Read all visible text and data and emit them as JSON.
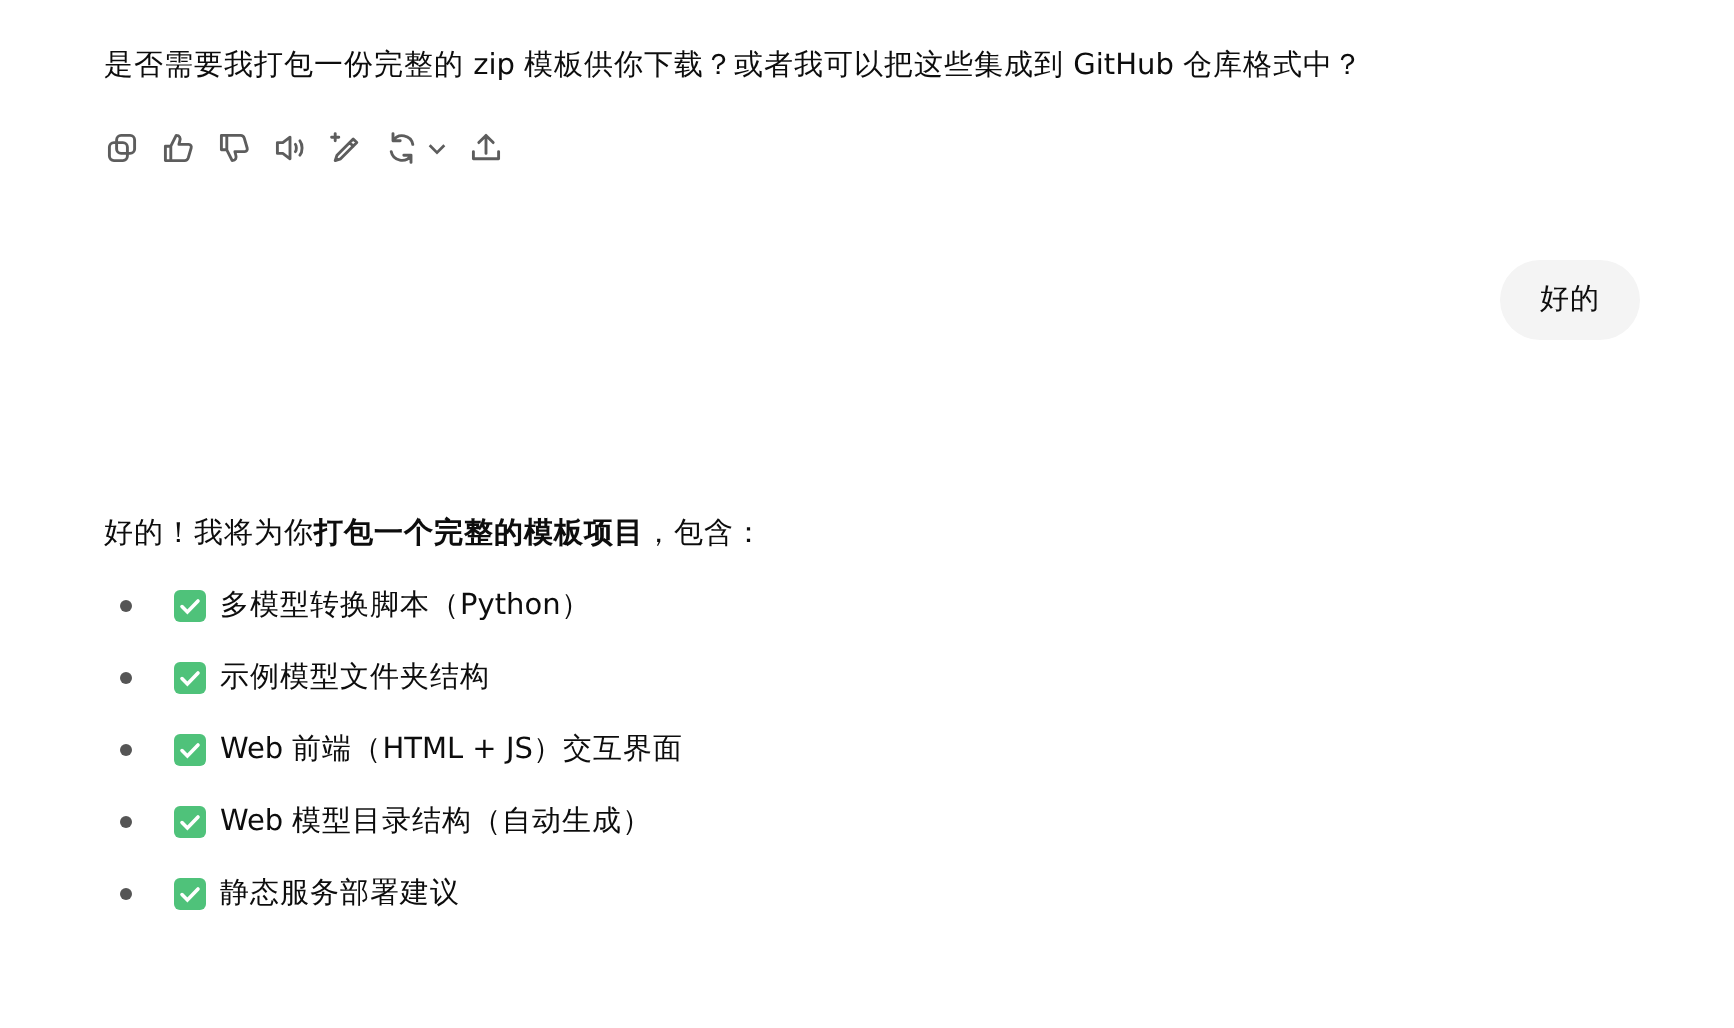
{
  "assistant_message": {
    "text": "是否需要我打包一份完整的 zip 模板供你下载？或者我可以把这些集成到 GitHub 仓库格式中？"
  },
  "actions": [
    {
      "kind": "copy"
    },
    {
      "kind": "like"
    },
    {
      "kind": "dislike"
    },
    {
      "kind": "speak"
    },
    {
      "kind": "edit"
    },
    {
      "kind": "regenerate"
    },
    {
      "kind": "share"
    }
  ],
  "user_message": {
    "text": "好的"
  },
  "reply": {
    "intro": "好的！我将为你**打包一个完整的模板项目**，包含：",
    "items": [
      {
        "text": "多模型转换脚本（Python）",
        "checked": true
      },
      {
        "text": "示例模型文件夹结构",
        "checked": true
      },
      {
        "text": "Web 前端（HTML + JS）交互界面",
        "checked": true
      },
      {
        "text": "Web 模型目录结构（自动生成）",
        "checked": true
      },
      {
        "text": "静态服务部署建议",
        "checked": true
      }
    ]
  }
}
